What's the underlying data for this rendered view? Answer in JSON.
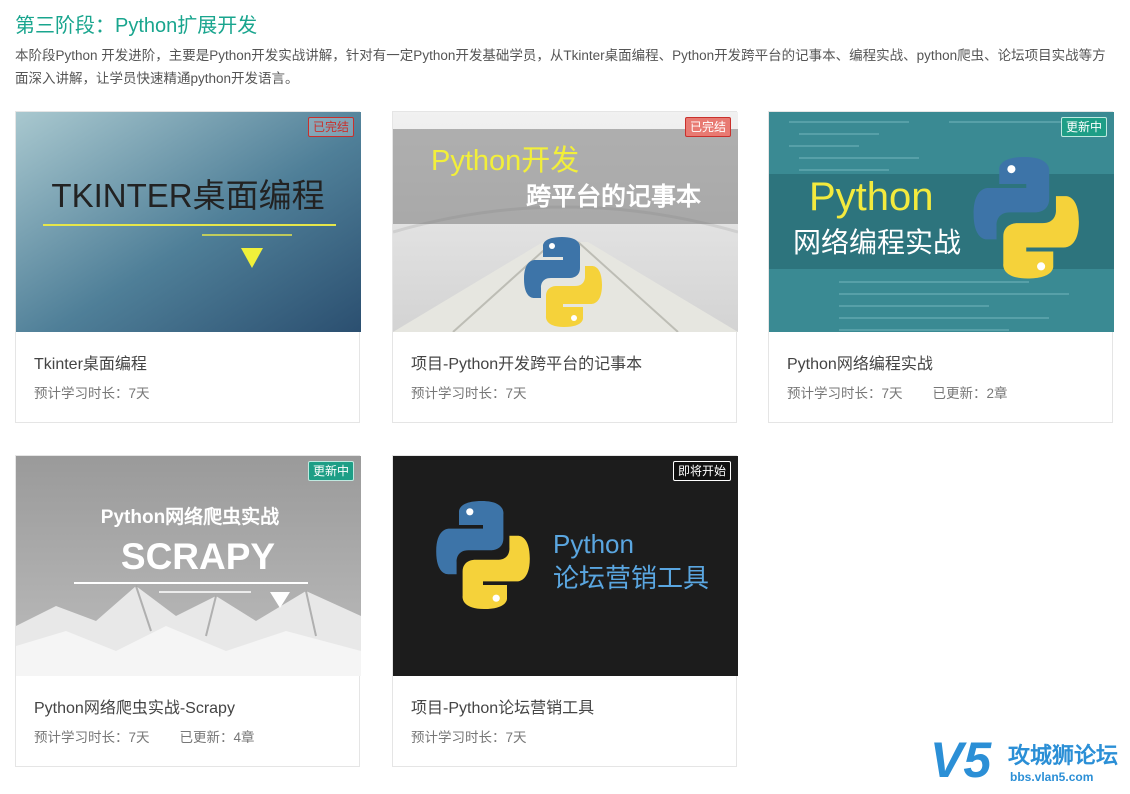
{
  "stage": {
    "title": "第三阶段：Python扩展开发",
    "description": "本阶段Python 开发进阶，主要是Python开发实战讲解，针对有一定Python开发基础学员，从Tkinter桌面编程、Python开发跨平台的记事本、编程实战、python爬虫、论坛项目实战等方面深入讲解，让学员快速精通python开发语言。"
  },
  "courses": [
    {
      "title": "Tkinter桌面编程",
      "duration": "预计学习时长：7天",
      "updated": "",
      "badge": "已完结",
      "badge_color": "#c9302c",
      "thumb_text": "TKINTER桌面编程"
    },
    {
      "title": "项目-Python开发跨平台的记事本",
      "duration": "预计学习时长：7天",
      "updated": "",
      "badge": "已完结",
      "badge_color": "#c9302c",
      "thumb_text_1": "Python开发",
      "thumb_text_2": "跨平台的记事本"
    },
    {
      "title": "Python网络编程实战",
      "duration": "预计学习时长：7天",
      "updated": "已更新：2章",
      "badge": "更新中",
      "badge_color": "#1e9e86",
      "thumb_text_1": "Python",
      "thumb_text_2": "网络编程实战"
    },
    {
      "title": "Python网络爬虫实战-Scrapy",
      "duration": "预计学习时长：7天",
      "updated": "已更新：4章",
      "badge": "更新中",
      "badge_color": "#1e9e86",
      "thumb_text_1": "Python网络爬虫实战",
      "thumb_text_2": "SCRAPY"
    },
    {
      "title": "项目-Python论坛营销工具",
      "duration": "预计学习时长：7天",
      "updated": "",
      "badge": "即将开始",
      "badge_color": "#ffffff",
      "thumb_text_1": "Python",
      "thumb_text_2": "论坛营销工具"
    }
  ],
  "watermark": {
    "logo": "V5",
    "name": "攻城狮论坛",
    "url": "bbs.vlan5.com"
  }
}
